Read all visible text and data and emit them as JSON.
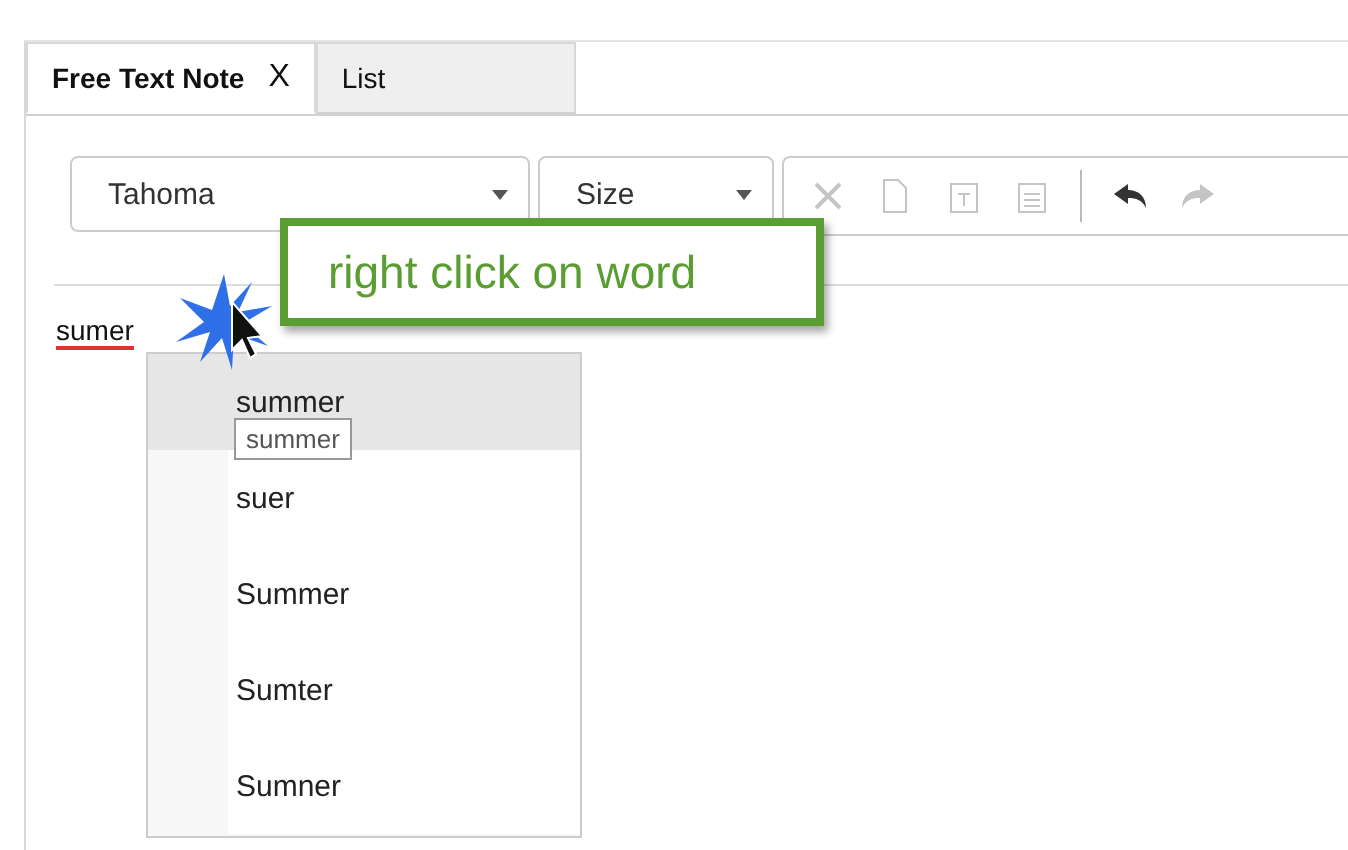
{
  "tabs": [
    {
      "label": "Free Text Note",
      "selected": true,
      "close": "X"
    },
    {
      "label": "List",
      "selected": false
    }
  ],
  "toolbar": {
    "font": "Tahoma",
    "size": "Size",
    "buttons": [
      {
        "kind": "cut",
        "disabled": true
      },
      {
        "kind": "copy",
        "disabled": true
      },
      {
        "kind": "paste-text",
        "disabled": true
      },
      {
        "kind": "paste",
        "disabled": true
      },
      {
        "kind": "separator"
      },
      {
        "kind": "undo",
        "disabled": false
      },
      {
        "kind": "redo",
        "disabled": true
      }
    ]
  },
  "editor": {
    "word": "sumer",
    "misspelled": true
  },
  "callout": "right click on word",
  "menu": {
    "items": [
      {
        "label": "summer",
        "selected": true
      },
      {
        "label": "suer",
        "selected": false
      },
      {
        "label": "Summer",
        "selected": false
      },
      {
        "label": "Sumter",
        "selected": false
      },
      {
        "label": "Sumner",
        "selected": false
      }
    ],
    "tooltip": "summer"
  }
}
